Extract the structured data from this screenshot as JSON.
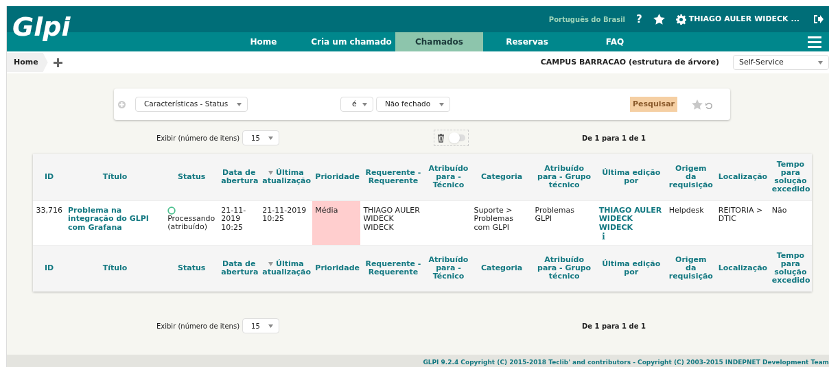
{
  "header": {
    "logo": "Glpi",
    "language": "Português do Brasil",
    "help": "?",
    "user": "THIAGO AULER WIDECK ..."
  },
  "nav": [
    {
      "label": "Home",
      "selected": false
    },
    {
      "label": "Cria um chamado",
      "selected": false
    },
    {
      "label": "Chamados",
      "selected": true
    },
    {
      "label": "Reservas",
      "selected": false
    },
    {
      "label": "FAQ",
      "selected": false
    }
  ],
  "breadcrumb": {
    "home": "Home",
    "entity": "CAMPUS BARRACAO (estrutura de árvore)",
    "profile": "Self-Service"
  },
  "search": {
    "field": "Características - Status",
    "operator": "é",
    "value": "Não fechado",
    "button": "Pesquisar"
  },
  "top_controls": {
    "label": "Exibir (número de itens)",
    "count": "15",
    "pager": "De 1 para 1 de 1",
    "toggle_on": false
  },
  "header_columns": [
    {
      "label": "ID",
      "sorted": false
    },
    {
      "label": "Título",
      "sorted": false
    },
    {
      "label": "Status",
      "sorted": false
    },
    {
      "label": "Data de abertura",
      "sorted": false
    },
    {
      "label": "Última atualização",
      "sorted": true
    },
    {
      "label": "Prioridade",
      "sorted": false
    },
    {
      "label": "Requerente - Requerente",
      "sorted": false
    },
    {
      "label": "Atribuído para - Técnico",
      "sorted": false
    },
    {
      "label": "Categoria",
      "sorted": false
    },
    {
      "label": "Atribuído para - Grupo técnico",
      "sorted": false
    },
    {
      "label": "Última edição por",
      "sorted": false
    },
    {
      "label": "Origem da requisição",
      "sorted": false
    },
    {
      "label": "Localização",
      "sorted": false
    },
    {
      "label": "Tempo para solução excedido",
      "sorted": false
    }
  ],
  "rows": [
    {
      "id": "33,716",
      "title": "Problema na integração do GLPI com Grafana",
      "status": {
        "label": "Processando (atribuído)",
        "color": "#49bf8d"
      },
      "opened": "21-11-2019 10:25",
      "updated": "21-11-2019 10:25",
      "priority": {
        "label": "Média",
        "color": "#ffcece"
      },
      "requester": "THIAGO AULER WIDECK WIDECK",
      "category": "Suporte > Problemas com GLPI",
      "group": "Problemas GLPI",
      "last_editor": "THIAGO AULER WIDECK WIDECK",
      "origin": "Helpdesk",
      "location": "REITORIA > DTIC",
      "sla": "Não"
    }
  ],
  "footer_columns": [
    {
      "label": "ID",
      "sorted": false
    },
    {
      "label": "Título",
      "sorted": false
    },
    {
      "label": "Status",
      "sorted": false
    },
    {
      "label": "Data de abertura",
      "sorted": false
    },
    {
      "label": "Última atualização",
      "sorted": true
    },
    {
      "label": "Prioridade",
      "sorted": false
    },
    {
      "label": "Requerente - Requerente",
      "sorted": false
    },
    {
      "label": "Atribuído para - Técnico",
      "sorted": false
    },
    {
      "label": "Categoria",
      "sorted": false
    },
    {
      "label": "Atribuído para - Grupo técnico",
      "sorted": false
    },
    {
      "label": "Última edição por",
      "sorted": false
    },
    {
      "label": "Origem da requisição",
      "sorted": false
    },
    {
      "label": "Localização",
      "sorted": false
    },
    {
      "label": "Tempo para solução excedido",
      "sorted": false
    }
  ],
  "bottom_controls": {
    "label": "Exibir (número de itens)",
    "count": "15",
    "pager": "De 1 para 1 de 1"
  },
  "footer": "GLPI 9.2.4 Copyright (C) 2015-2018 Teclib' and contributors - Copyright (C) 2003-2015 INDEPNET Development Team"
}
